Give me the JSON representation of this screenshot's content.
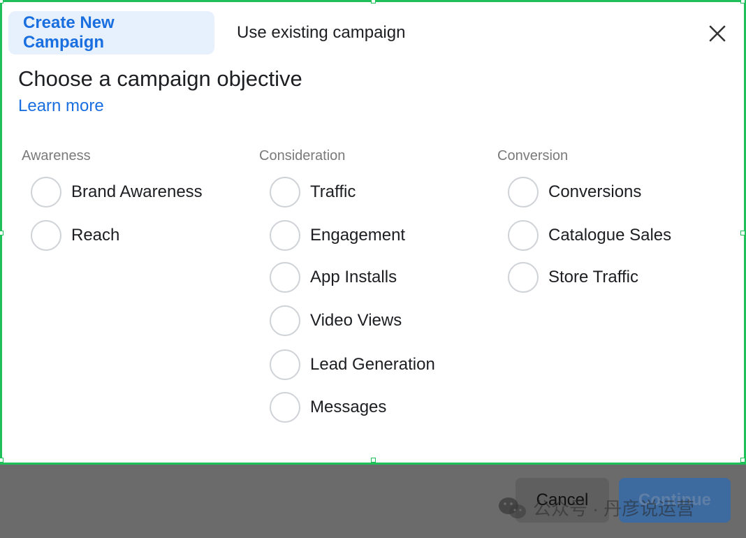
{
  "tabs": [
    {
      "label": "Create New Campaign",
      "active": true
    },
    {
      "label": "Use existing campaign",
      "active": false
    }
  ],
  "heading": "Choose a campaign objective",
  "learn_more": "Learn more",
  "columns": [
    {
      "title": "Awareness",
      "options": [
        "Brand Awareness",
        "Reach"
      ]
    },
    {
      "title": "Consideration",
      "options": [
        "Traffic",
        "Engagement",
        "App Installs",
        "Video Views",
        "Lead Generation",
        "Messages"
      ]
    },
    {
      "title": "Conversion",
      "options": [
        "Conversions",
        "Catalogue Sales",
        "Store Traffic"
      ]
    }
  ],
  "footer": {
    "cancel": "Cancel",
    "continue": "Continue"
  },
  "watermark": "公众号 · 丹彦说运营",
  "colors": {
    "accent": "#1a6fe0",
    "active_tab_bg": "#e7f0fd",
    "selection_border": "#1fbf5a"
  }
}
